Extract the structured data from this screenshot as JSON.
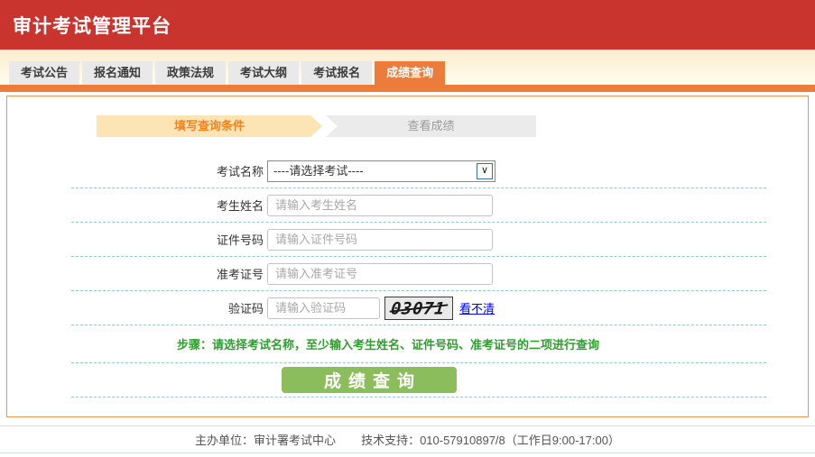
{
  "header": {
    "title": "审计考试管理平台"
  },
  "tabs": [
    {
      "label": "考试公告",
      "active": false
    },
    {
      "label": "报名通知",
      "active": false
    },
    {
      "label": "政策法规",
      "active": false
    },
    {
      "label": "考试大纲",
      "active": false
    },
    {
      "label": "考试报名",
      "active": false
    },
    {
      "label": "成绩查询",
      "active": true
    }
  ],
  "steps": [
    {
      "label": "填写查询条件",
      "active": true
    },
    {
      "label": "查看成绩",
      "active": false
    }
  ],
  "form": {
    "fields": [
      {
        "label": "考试名称",
        "type": "select",
        "value": "----请选择考试----"
      },
      {
        "label": "考生姓名",
        "type": "input",
        "placeholder": "请输入考生姓名"
      },
      {
        "label": "证件号码",
        "type": "input",
        "placeholder": "请输入证件号码"
      },
      {
        "label": "准考证号",
        "type": "input",
        "placeholder": "请输入准考证号"
      },
      {
        "label": "验证码",
        "type": "captcha",
        "placeholder": "请输入验证码",
        "captcha_text": "03071",
        "refresh_link": "看不清"
      }
    ],
    "note": "步骤：请选择考试名称，至少输入考生姓名、证件号码、准考证号的二项进行查询",
    "submit_label": "成绩查询"
  },
  "footer": {
    "sponsor": "主办单位：审计署考试中心",
    "support": "技术支持：010-57910897/8（工作日9:00-17:00）"
  },
  "colors": {
    "header_red": "#c9342e",
    "accent_orange": "#ec7c3c",
    "box_border_orange": "#e8945e",
    "step_active_bg": "#fce4b4",
    "step_active_text": "#f5821f",
    "separator_teal": "#9cc7c7",
    "note_green": "#2f9e2f",
    "button_green": "#8bbd5c",
    "link_blue": "#0000e6"
  }
}
